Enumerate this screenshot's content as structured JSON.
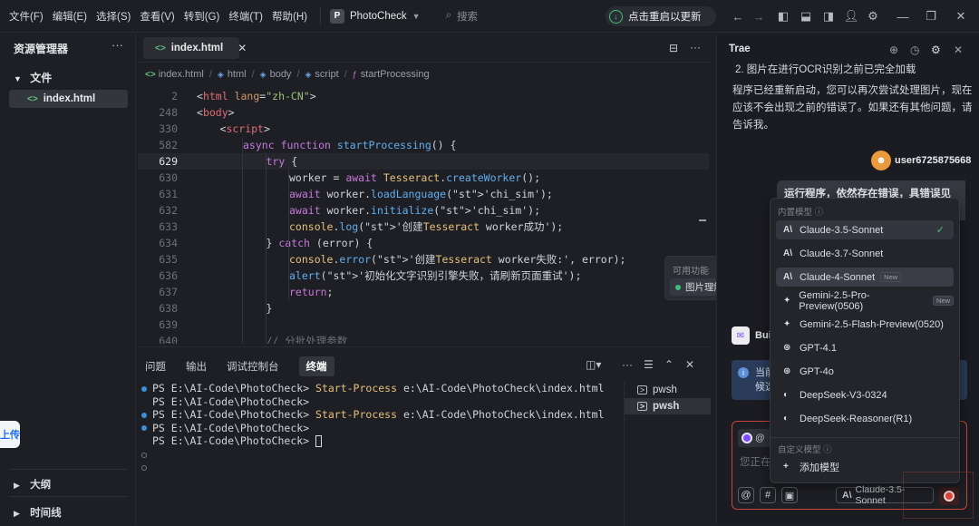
{
  "menu": [
    "文件(F)",
    "编辑(E)",
    "选择(S)",
    "查看(V)",
    "转到(G)",
    "终端(T)",
    "帮助(H)"
  ],
  "project": {
    "badge": "P",
    "name": "PhotoCheck"
  },
  "search": {
    "placeholder": "搜索"
  },
  "update_button": "点击重启以更新",
  "sidebar": {
    "title": "资源管理器",
    "folder": "文件",
    "file": "index.html",
    "sections": [
      "大纲",
      "时间线"
    ],
    "upload": "上传"
  },
  "editor": {
    "tab": "index.html",
    "breadcrumb": [
      "index.html",
      "html",
      "body",
      "script",
      "startProcessing"
    ],
    "lines": [
      {
        "n": "2",
        "text": "<html lang=\"zh-CN\">"
      },
      {
        "n": "248",
        "text": "<body>"
      },
      {
        "n": "330",
        "text": "<script>"
      },
      {
        "n": "582",
        "text": "async function startProcessing() {"
      },
      {
        "n": "629",
        "text": "try {"
      },
      {
        "n": "630",
        "text": "worker = await Tesseract.createWorker();"
      },
      {
        "n": "631",
        "text": "await worker.loadLanguage('chi_sim');"
      },
      {
        "n": "632",
        "text": "await worker.initialize('chi_sim');"
      },
      {
        "n": "633",
        "text": "console.log('创建Tesseract worker成功');"
      },
      {
        "n": "634",
        "text": "} catch (error) {"
      },
      {
        "n": "635",
        "text": "console.error('创建Tesseract worker失败:', error);"
      },
      {
        "n": "636",
        "text": "alert('初始化文字识别引擎失败，请刷新页面重试');"
      },
      {
        "n": "637",
        "text": "return;"
      },
      {
        "n": "638",
        "text": "}"
      },
      {
        "n": "639",
        "text": ""
      },
      {
        "n": "640",
        "text": "// 分批处理参数"
      }
    ]
  },
  "tooltip": {
    "title": "可用功能",
    "item": "图片理解"
  },
  "panel": {
    "tabs": [
      "问题",
      "输出",
      "调试控制台",
      "终端"
    ],
    "active_tab": "终端",
    "terminal": [
      {
        "prompt": "PS E:\\AI-Code\\PhotoCheck>",
        "cmd": "Start-Process",
        "arg": "e:\\AI-Code\\PhotoCheck\\index.html",
        "dot": "blue"
      },
      {
        "prompt": "PS E:\\AI-Code\\PhotoCheck>",
        "cmd": "",
        "arg": "",
        "dot": "none"
      },
      {
        "prompt": "PS E:\\AI-Code\\PhotoCheck>",
        "cmd": "Start-Process",
        "arg": "e:\\AI-Code\\PhotoCheck\\index.html",
        "dot": "blue"
      },
      {
        "prompt": "PS E:\\AI-Code\\PhotoCheck>",
        "cmd": "",
        "arg": "",
        "dot": "blue"
      },
      {
        "prompt": "PS E:\\AI-Code\\PhotoCheck>",
        "cmd": "",
        "arg": "",
        "dot": "none"
      }
    ],
    "shells": [
      "pwsh",
      "pwsh"
    ]
  },
  "chat": {
    "title": "Trae",
    "list_item": "2. 图片在进行OCR识别之前已完全加载",
    "reply": [
      "程序已经重新启动，您可以再次尝试处理图片，现在",
      "应该不会出现之前的错误了。如果还有其他问题，请",
      "告诉我。"
    ],
    "user": "user6725875668",
    "user_message": "运行程序，依然存在错误，具错误见",
    "bot_name": "Buil",
    "info_text": [
      "当前",
      "候选"
    ],
    "input_chip": "@",
    "input_placeholder": "您正在",
    "current_model": "Claude-3.5-Sonnet"
  },
  "model_menu": {
    "builtin_label": "内置模型",
    "custom_label": "自定义模型",
    "add_model": "添加模型",
    "new_badge": "New",
    "models": [
      {
        "name": "Claude-3.5-Sonnet",
        "icon": "anthropic-icon",
        "selected": true,
        "new": false
      },
      {
        "name": "Claude-3.7-Sonnet",
        "icon": "anthropic-icon",
        "selected": false,
        "new": false
      },
      {
        "name": "Claude-4-Sonnet",
        "icon": "anthropic-icon",
        "selected": false,
        "new": true
      },
      {
        "name": "Gemini-2.5-Pro-Preview(0506)",
        "icon": "gemini-icon",
        "selected": false,
        "new": true
      },
      {
        "name": "Gemini-2.5-Flash-Preview(0520)",
        "icon": "gemini-icon",
        "selected": false,
        "new": false
      },
      {
        "name": "GPT-4.1",
        "icon": "openai-icon",
        "selected": false,
        "new": false
      },
      {
        "name": "GPT-4o",
        "icon": "openai-icon",
        "selected": false,
        "new": false
      },
      {
        "name": "DeepSeek-V3-0324",
        "icon": "deepseek-icon",
        "selected": false,
        "new": false
      },
      {
        "name": "DeepSeek-Reasoner(R1)",
        "icon": "deepseek-icon",
        "selected": false,
        "new": false
      }
    ]
  },
  "colors": {
    "accent_green": "#3fc07a",
    "error_red": "#e0473c",
    "keyword": "#c678dd",
    "string": "#98c379"
  }
}
